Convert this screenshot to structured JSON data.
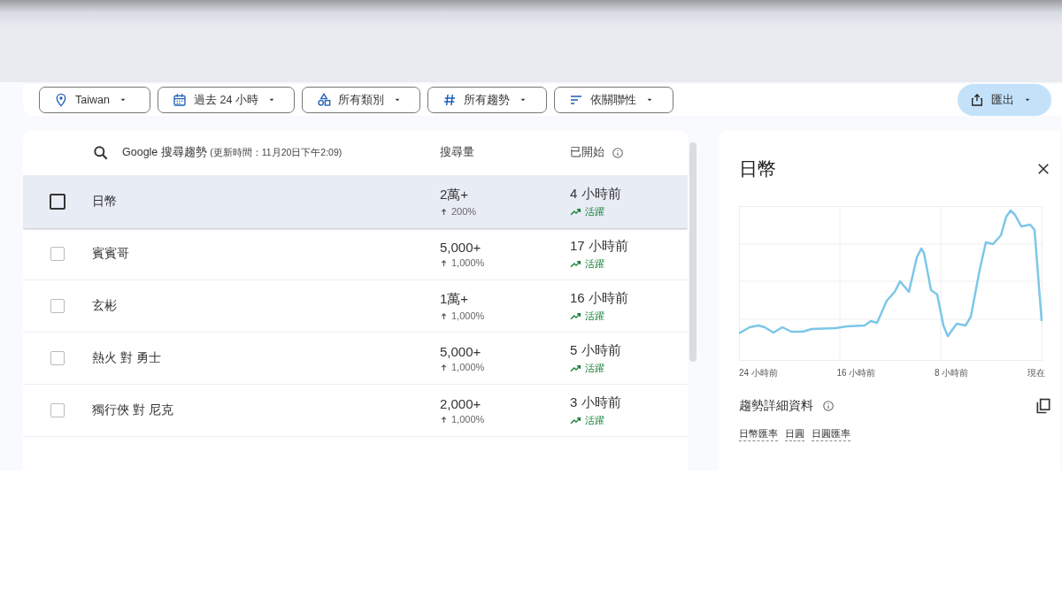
{
  "filters": [
    {
      "kind": "location",
      "label": "Taiwan"
    },
    {
      "kind": "time",
      "label": "過去 24 小時"
    },
    {
      "kind": "category",
      "label": "所有類別"
    },
    {
      "kind": "trend",
      "label": "所有趨勢"
    },
    {
      "kind": "sort",
      "label": "依關聯性"
    }
  ],
  "export_button": {
    "label": "匯出"
  },
  "table": {
    "columns": [
      {
        "label": "Google 搜尋趨勢",
        "note": "(更新時間：11月20日下午2:09)"
      },
      {
        "label": "搜尋量"
      },
      {
        "label": "已開始"
      }
    ],
    "rows": [
      {
        "name": "日幣",
        "volume": "2萬+",
        "growth": "200%",
        "started": "4 小時前",
        "status": "活躍",
        "selected": true
      },
      {
        "name": "賓賓哥",
        "volume": "5,000+",
        "growth": "1,000%",
        "started": "17 小時前",
        "status": "活躍",
        "selected": false
      },
      {
        "name": "玄彬",
        "volume": "1萬+",
        "growth": "1,000%",
        "started": "16 小時前",
        "status": "活躍",
        "selected": false
      },
      {
        "name": "熱火 對 勇士",
        "volume": "5,000+",
        "growth": "1,000%",
        "started": "5 小時前",
        "status": "活躍",
        "selected": false
      },
      {
        "name": "獨行俠 對 尼克",
        "volume": "2,000+",
        "growth": "1,000%",
        "started": "3 小時前",
        "status": "活躍",
        "selected": false
      }
    ]
  },
  "detail": {
    "title": "日幣",
    "chart": {
      "x_labels": [
        "24 小時前",
        "16 小時前",
        "8 小時前",
        "現在"
      ]
    },
    "details_title": "趨勢詳細資料",
    "tags": [
      "日幣匯率",
      "日圓",
      "日圓匯率"
    ]
  }
}
